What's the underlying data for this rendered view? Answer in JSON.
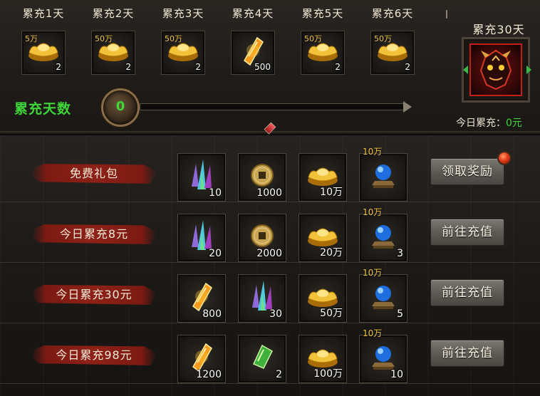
{
  "daily_rewards": [
    {
      "title": "累充1天",
      "tag": "5万",
      "count": "2",
      "icon": "gold-ingot"
    },
    {
      "title": "累充2天",
      "tag": "50万",
      "count": "2",
      "icon": "gold-ingot"
    },
    {
      "title": "累充3天",
      "tag": "50万",
      "count": "2",
      "icon": "gold-ingot"
    },
    {
      "title": "累充4天",
      "tag": "",
      "count": "500",
      "icon": "orange-talisman"
    },
    {
      "title": "累充5天",
      "tag": "50万",
      "count": "2",
      "icon": "gold-ingot"
    },
    {
      "title": "累充6天",
      "tag": "50万",
      "count": "2",
      "icon": "gold-ingot"
    }
  ],
  "progress": {
    "label": "累充天数",
    "value": "0",
    "fraction": 0
  },
  "final_reward": {
    "title": "累充30天",
    "icon": "demon-mask"
  },
  "today_total": {
    "label": "今日累充：",
    "value": "0元"
  },
  "rows": [
    {
      "label": "免费礼包",
      "button": "领取奖励",
      "has_red_dot": true,
      "items": [
        {
          "icon": "crystal-shards",
          "tag": "",
          "count": "10"
        },
        {
          "icon": "copper-coin",
          "tag": "",
          "count": "1000"
        },
        {
          "icon": "gold-ingot",
          "tag": "",
          "count": "10万"
        },
        {
          "icon": "blue-orb",
          "tag": "10万",
          "count": ""
        }
      ]
    },
    {
      "label": "今日累充8元",
      "button": "前往充值",
      "has_red_dot": false,
      "items": [
        {
          "icon": "crystal-shards",
          "tag": "",
          "count": "20"
        },
        {
          "icon": "copper-coin",
          "tag": "",
          "count": "2000"
        },
        {
          "icon": "gold-ingot",
          "tag": "",
          "count": "20万"
        },
        {
          "icon": "blue-orb",
          "tag": "10万",
          "count": "3"
        }
      ]
    },
    {
      "label": "今日累充30元",
      "button": "前往充值",
      "has_red_dot": false,
      "items": [
        {
          "icon": "orange-talisman",
          "tag": "",
          "count": "800"
        },
        {
          "icon": "crystal-shards",
          "tag": "",
          "count": "30"
        },
        {
          "icon": "gold-ingot",
          "tag": "",
          "count": "50万"
        },
        {
          "icon": "blue-orb",
          "tag": "10万",
          "count": "5"
        }
      ]
    },
    {
      "label": "今日累充98元",
      "button": "前往充值",
      "has_red_dot": false,
      "items": [
        {
          "icon": "orange-talisman",
          "tag": "",
          "count": "1200"
        },
        {
          "icon": "green-jade",
          "tag": "",
          "count": "2"
        },
        {
          "icon": "gold-ingot",
          "tag": "",
          "count": "100万"
        },
        {
          "icon": "blue-orb",
          "tag": "10万",
          "count": "10"
        }
      ]
    }
  ],
  "colors": {
    "accent_green": "#3fd637",
    "tag_gold": "#f3c63d",
    "label_red": "#8d2117"
  }
}
